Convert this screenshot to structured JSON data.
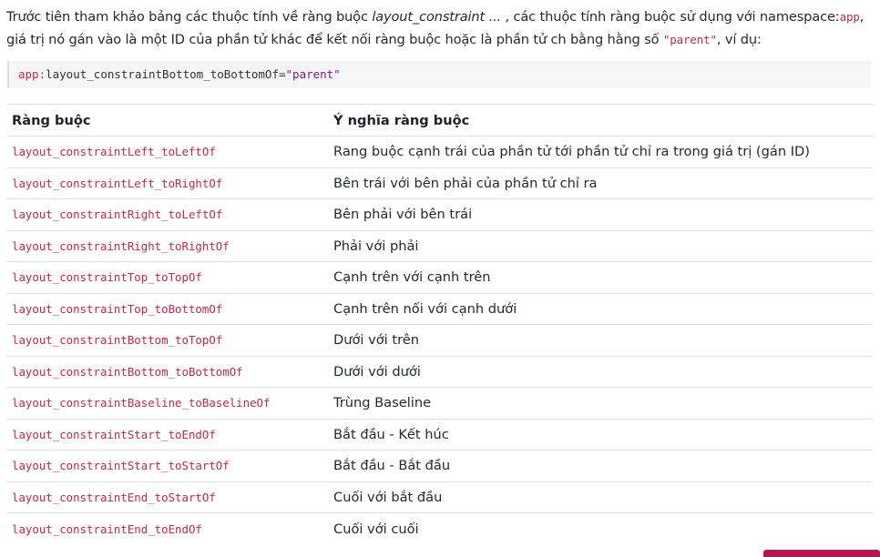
{
  "intro": {
    "part1": "Trước tiên tham khảo bảng các thuộc tính về ràng buộc ",
    "emph": "layout_constraint ...",
    "part2": " , các thuộc tính ràng buộc sử dụng với namespace:",
    "ns_code": "app",
    "part3": ", giá trị nó gán vào là một ID của phần tử khác để kết nối ràng buộc hoặc là phần tử ch bằng hằng số ",
    "parent_code": "\"parent\"",
    "part4": ", ví dụ:"
  },
  "code_example": {
    "ns": "app:",
    "attr": "layout_constraintBottom_toBottomOf=",
    "value": "\"parent\""
  },
  "table": {
    "headers": [
      "Ràng buộc",
      "Ý nghĩa ràng buộc"
    ],
    "rows": [
      [
        "layout_constraintLeft_toLeftOf",
        "Rang buộc cạnh trái của phần tử tới phần tử chỉ ra trong giá trị (gán ID)"
      ],
      [
        "layout_constraintLeft_toRightOf",
        "Bên trái với bên phải của phần tử chỉ ra"
      ],
      [
        "layout_constraintRight_toLeftOf",
        "Bên phải với bên trái"
      ],
      [
        "layout_constraintRight_toRightOf",
        "Phải với phải"
      ],
      [
        "layout_constraintTop_toTopOf",
        "Cạnh trên với cạnh trên"
      ],
      [
        "layout_constraintTop_toBottomOf",
        "Cạnh trên nối với cạnh dưới"
      ],
      [
        "layout_constraintBottom_toTopOf",
        "Dưới với trên"
      ],
      [
        "layout_constraintBottom_toBottomOf",
        "Dưới với dưới"
      ],
      [
        "layout_constraintBaseline_toBaselineOf",
        "Trùng Baseline"
      ],
      [
        "layout_constraintStart_toEndOf",
        "Bắt đầu - Kết húc"
      ],
      [
        "layout_constraintStart_toStartOf",
        "Bắt đầu - Bắt đầu"
      ],
      [
        "layout_constraintEnd_toStartOf",
        "Cuối với bắt đầu"
      ],
      [
        "layout_constraintEnd_toEndOf",
        "Cuối với cuối"
      ]
    ]
  },
  "colors": {
    "code_accent": "#c7254e",
    "string_value": "#881280",
    "corner_button": "#b7174f"
  }
}
